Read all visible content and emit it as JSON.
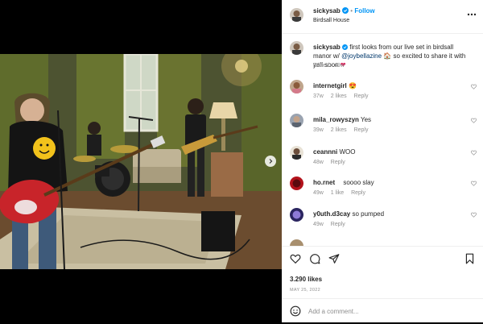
{
  "post": {
    "author": "sickysab",
    "follow_label": "Follow",
    "location": "Birdsall House",
    "caption_prefix": "first looks from our live set in birdsall manor w/",
    "caption_mention": "@joybellazine",
    "caption_suffix": "so excited to share it with yall soon",
    "caption_time": "Edited · 49w",
    "likes": "3.290 likes",
    "date": "MAY 25, 2022",
    "add_comment_placeholder": "Add a comment..."
  },
  "comments": [
    {
      "user": "internetgirl",
      "text": "",
      "emoji": "heart-eyes",
      "time": "37w",
      "likes": "2 likes",
      "reply": "Reply"
    },
    {
      "user": "mila_rowyszyn",
      "text": "Yes",
      "emoji": "",
      "time": "39w",
      "likes": "2 likes",
      "reply": "Reply"
    },
    {
      "user": "ceannni",
      "text": "WOO",
      "emoji": "",
      "time": "48w",
      "likes": "",
      "reply": "Reply"
    },
    {
      "user": "ho.rnet",
      "text": "soooo slay",
      "emoji": "",
      "time": "49w",
      "likes": "1 like",
      "reply": "Reply"
    },
    {
      "user": "y0uth.d3cay",
      "text": "so pumped",
      "emoji": "",
      "time": "49w",
      "likes": "",
      "reply": "Reply"
    }
  ],
  "icons": {
    "verified": "verified-badge-icon",
    "like": "heart-icon",
    "comment": "comment-icon",
    "share": "paper-plane-icon",
    "save": "bookmark-icon",
    "emoji": "smiley-icon",
    "next": "chevron-right-icon"
  },
  "colors": {
    "accent": "#0095f6",
    "verified": "#0095f6",
    "muted": "#8e8e8e",
    "text": "#262626"
  }
}
